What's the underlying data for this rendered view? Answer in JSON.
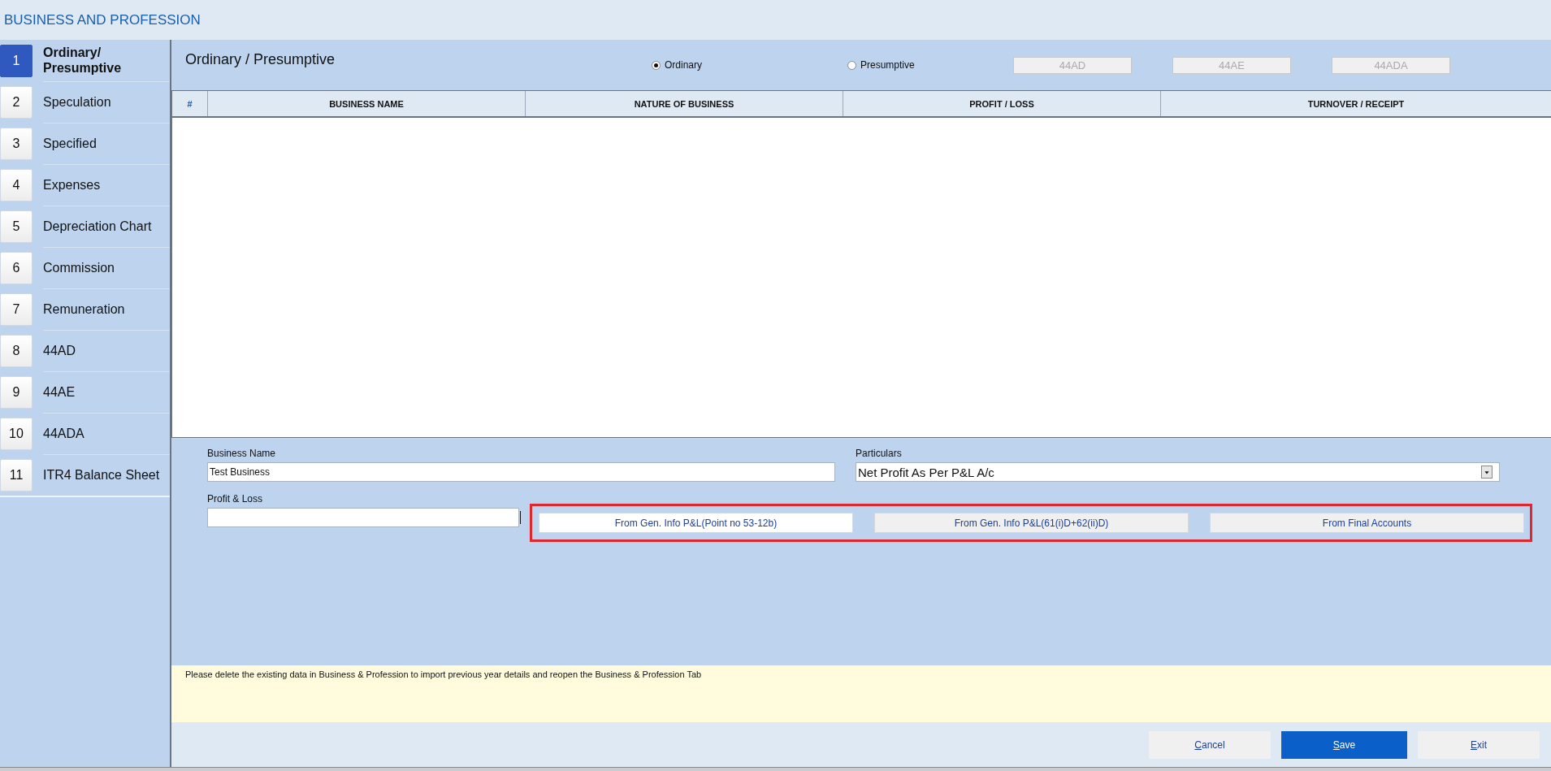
{
  "window": {
    "title": "BUSINESS AND PROFESSION"
  },
  "sidebar": {
    "items": [
      {
        "number": "1",
        "label": "Ordinary/ Presumptive",
        "selected": true
      },
      {
        "number": "2",
        "label": "Speculation",
        "selected": false
      },
      {
        "number": "3",
        "label": "Specified",
        "selected": false
      },
      {
        "number": "4",
        "label": "Expenses",
        "selected": false
      },
      {
        "number": "5",
        "label": "Depreciation Chart",
        "selected": false
      },
      {
        "number": "6",
        "label": "Commission",
        "selected": false
      },
      {
        "number": "7",
        "label": "Remuneration",
        "selected": false
      },
      {
        "number": "8",
        "label": "44AD",
        "selected": false
      },
      {
        "number": "9",
        "label": "44AE",
        "selected": false
      },
      {
        "number": "10",
        "label": "44ADA",
        "selected": false
      },
      {
        "number": "11",
        "label": "ITR4 Balance Sheet",
        "selected": false
      }
    ]
  },
  "section": {
    "title": "Ordinary / Presumptive",
    "radios": [
      {
        "label": "Ordinary",
        "selected": true
      },
      {
        "label": "Presumptive",
        "selected": false
      }
    ],
    "buttons": [
      {
        "label": "44AD",
        "disabled": true
      },
      {
        "label": "44AE",
        "disabled": true
      },
      {
        "label": "44ADA",
        "disabled": true
      }
    ]
  },
  "table": {
    "columns": [
      "#",
      "BUSINESS NAME",
      "NATURE OF BUSINESS",
      "PROFIT / LOSS",
      "TURNOVER / RECEIPT"
    ]
  },
  "form": {
    "business_name": {
      "label": "Business Name",
      "value": "Test Business"
    },
    "particulars": {
      "label": "Particulars",
      "value": "Net Profit As Per P&L A/c"
    },
    "profit_loss": {
      "label": "Profit & Loss"
    },
    "import_buttons": [
      {
        "label": "From Gen. Info P&L(Point no 53-12b)",
        "selected": true
      },
      {
        "label": "From Gen. Info P&L(61(i)D+62(ii)D)",
        "selected": false
      },
      {
        "label": "From Final Accounts",
        "selected": false
      }
    ]
  },
  "note": "Please delete the existing data in Business &  Profession to import previous year details and reopen the Business & Profession Tab",
  "actions": [
    {
      "label": "Cancel",
      "kind": "plain"
    },
    {
      "label": "Save",
      "kind": "primary"
    },
    {
      "label": "Exit",
      "kind": "plain"
    }
  ]
}
